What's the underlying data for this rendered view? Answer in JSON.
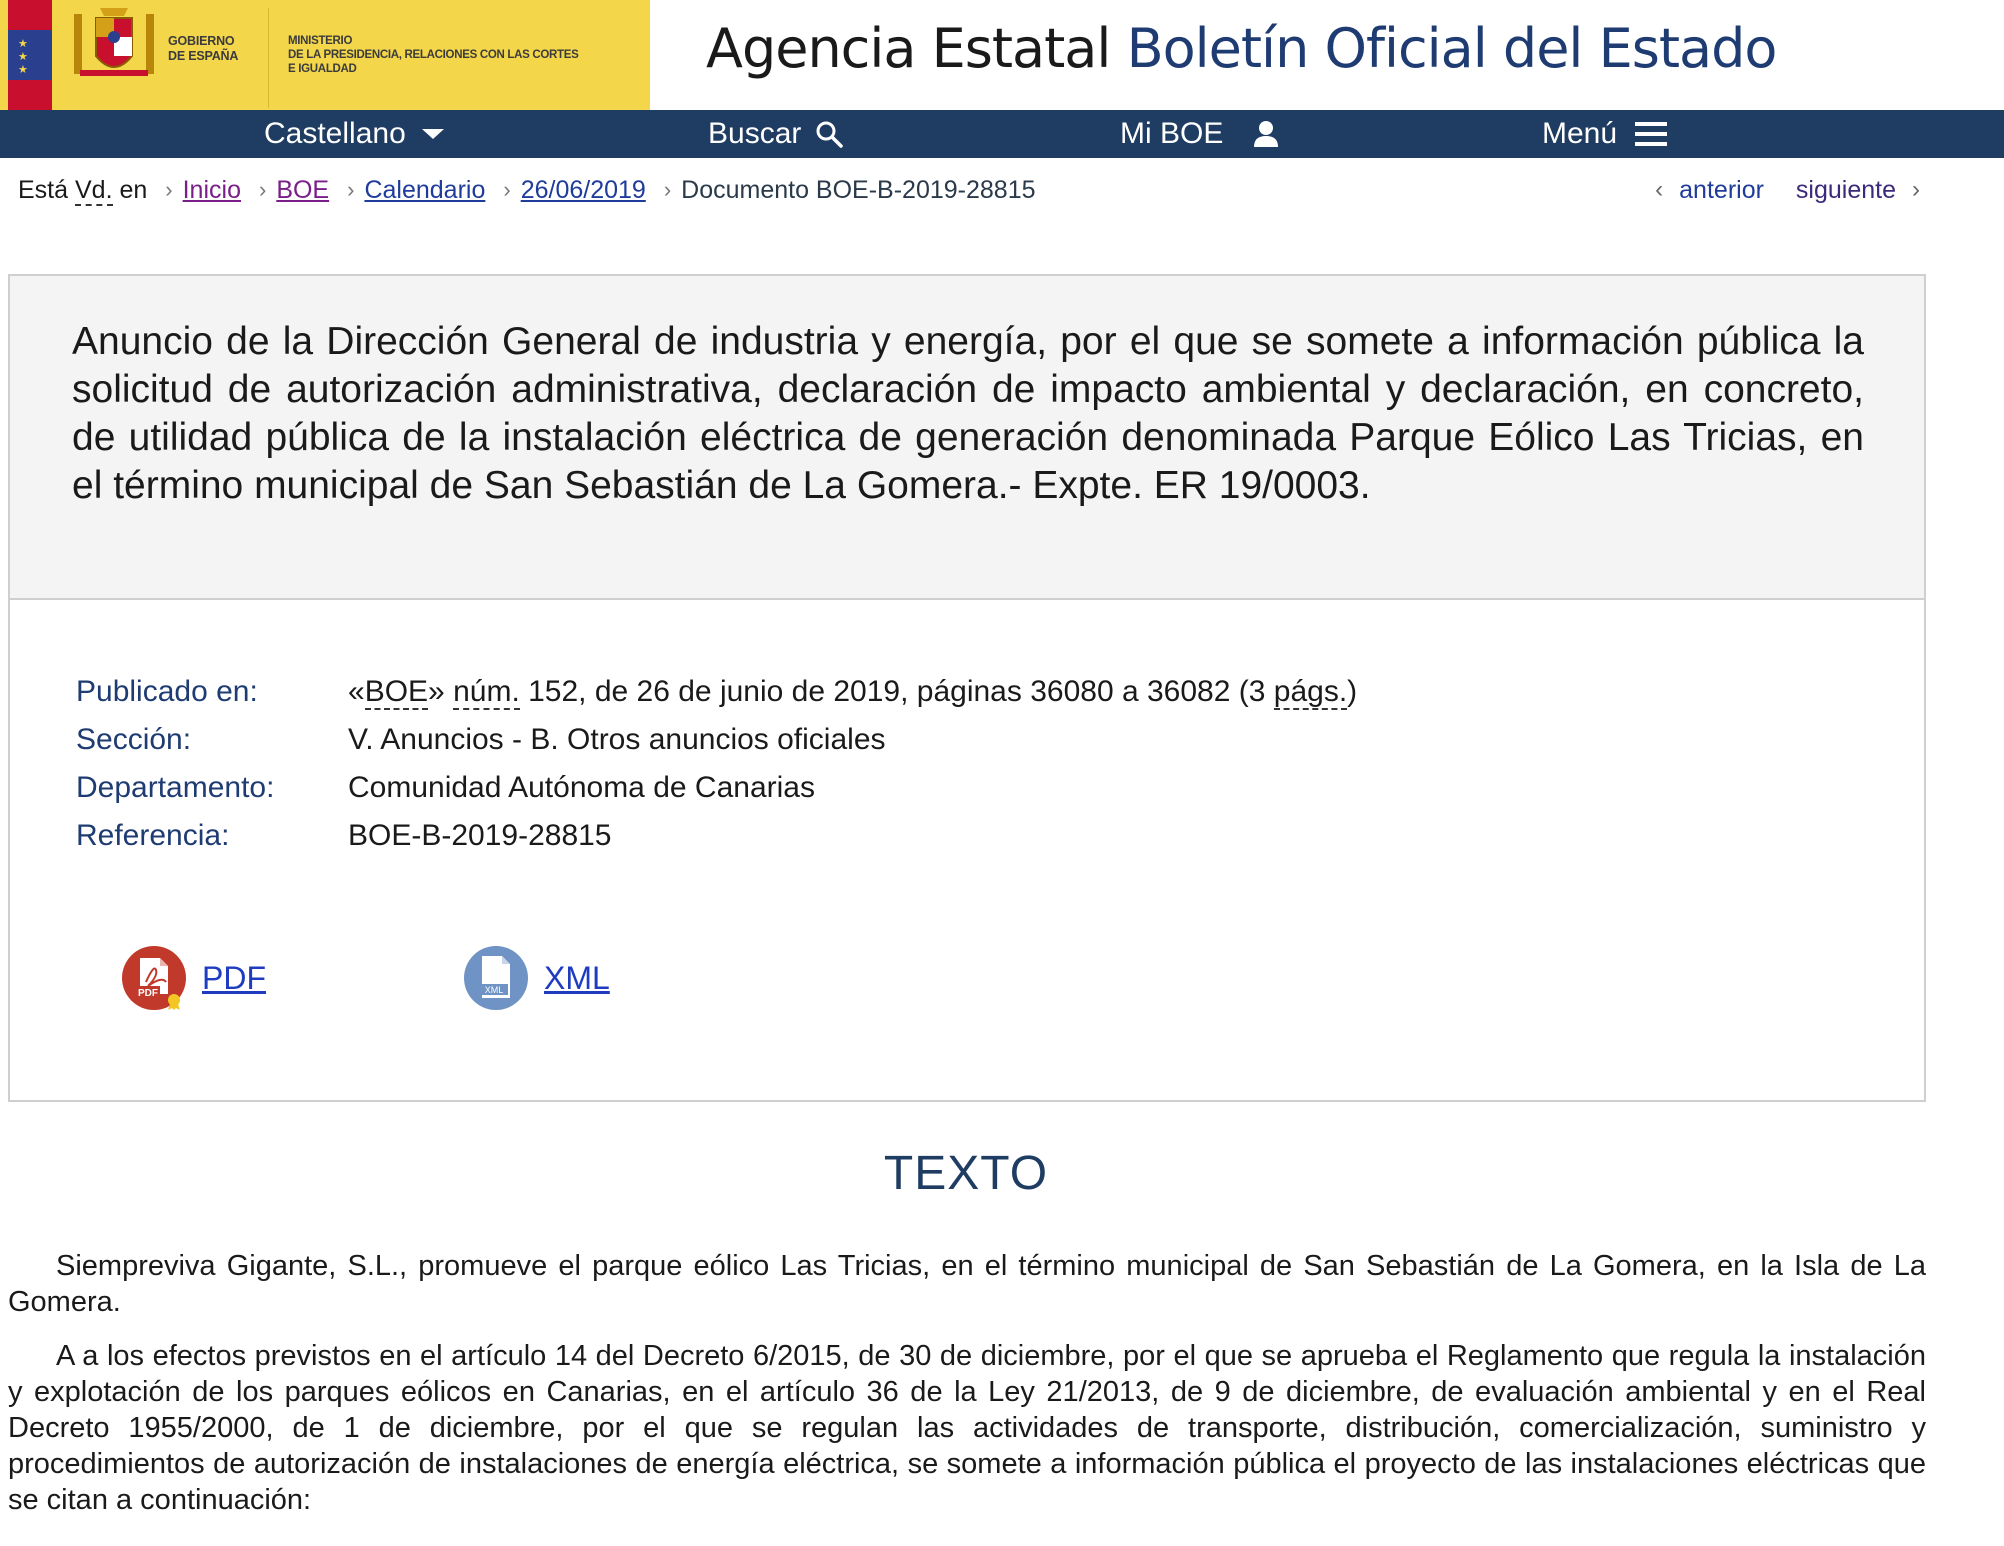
{
  "header": {
    "gov_label_line1": "GOBIERNO",
    "gov_label_line2": "DE ESPAÑA",
    "ministry_line1": "MINISTERIO",
    "ministry_line2": "DE LA PRESIDENCIA, RELACIONES CON LAS CORTES",
    "ministry_line3": "E IGUALDAD",
    "agency_prefix": "Agencia Estatal",
    "agency_accent": "Boletín Oficial del Estado"
  },
  "navbar": {
    "language": "Castellano",
    "search": "Buscar",
    "my_boe": "Mi BOE",
    "menu": "Menú"
  },
  "breadcrumb": {
    "prefix_a": "Está ",
    "prefix_abbr": "Vd.",
    "prefix_b": " en",
    "items": [
      "Inicio",
      "BOE",
      "Calendario",
      "26/06/2019"
    ],
    "current": "Documento BOE-B-2019-28815"
  },
  "pager": {
    "prev": "anterior",
    "next": "siguiente"
  },
  "document": {
    "title": "Anuncio de la Dirección General de industria y energía, por el que se somete a información pública la solicitud de autorización administrativa, declaración de impacto ambiental y declaración, en concreto, de utilidad pública de la instalación eléctrica de generación denominada Parque Eólico Las Tricias, en el término municipal de San Sebastián de La Gomera.- Expte. ER 19/0003.",
    "meta": {
      "published_label": "Publicado en:",
      "published_open": "«",
      "published_boe": "BOE",
      "published_mid": "» ",
      "published_num": "núm.",
      "published_rest": " 152, de 26 de junio de 2019, páginas 36080 a 36082 (3 ",
      "published_pags": "págs.",
      "published_close": ")",
      "section_label": "Sección:",
      "section_value": "V. Anuncios - B. Otros anuncios oficiales",
      "department_label": "Departamento:",
      "department_value": "Comunidad Autónoma de Canarias",
      "reference_label": "Referencia:",
      "reference_value": "BOE-B-2019-28815"
    },
    "downloads": {
      "pdf_label": "PDF",
      "pdf_icon_text": "PDF",
      "xml_label": "XML",
      "xml_icon_text": "XML"
    }
  },
  "texto": {
    "heading": "TEXTO",
    "paragraphs": [
      "Siempreviva Gigante, S.L., promueve el parque eólico Las Tricias, en el término municipal de San Sebastián de La Gomera, en la Isla de La Gomera.",
      "A a los efectos previstos en el artículo 14 del Decreto 6/2015, de 30 de diciembre, por el que se aprueba el Reglamento que regula la instalación y explotación de los parques eólicos en Canarias, en el artículo 36 de la Ley 21/2013, de 9 de diciembre, de evaluación ambiental y en el Real Decreto 1955/2000, de 1 de diciembre, por el que se regulan las actividades de transporte, distribución, comercialización, suministro y procedimientos de autorización de instalaciones de energía eléctrica, se somete a información pública el proyecto de las instalaciones eléctricas que se citan a continuación:"
    ]
  },
  "colors": {
    "navbar": "#1f3c62",
    "gov_yellow": "#f3d64a",
    "accent_blue": "#1f3c72",
    "pdf_red": "#c0392b",
    "xml_blue": "#6f93c4"
  },
  "icons": {
    "language_dropdown": "chevron-down-icon",
    "search": "search-icon",
    "user": "user-icon",
    "menu": "hamburger-icon",
    "prev": "chevron-left-icon",
    "next": "chevron-right-icon",
    "pdf": "pdf-file-icon",
    "xml": "xml-file-icon"
  }
}
